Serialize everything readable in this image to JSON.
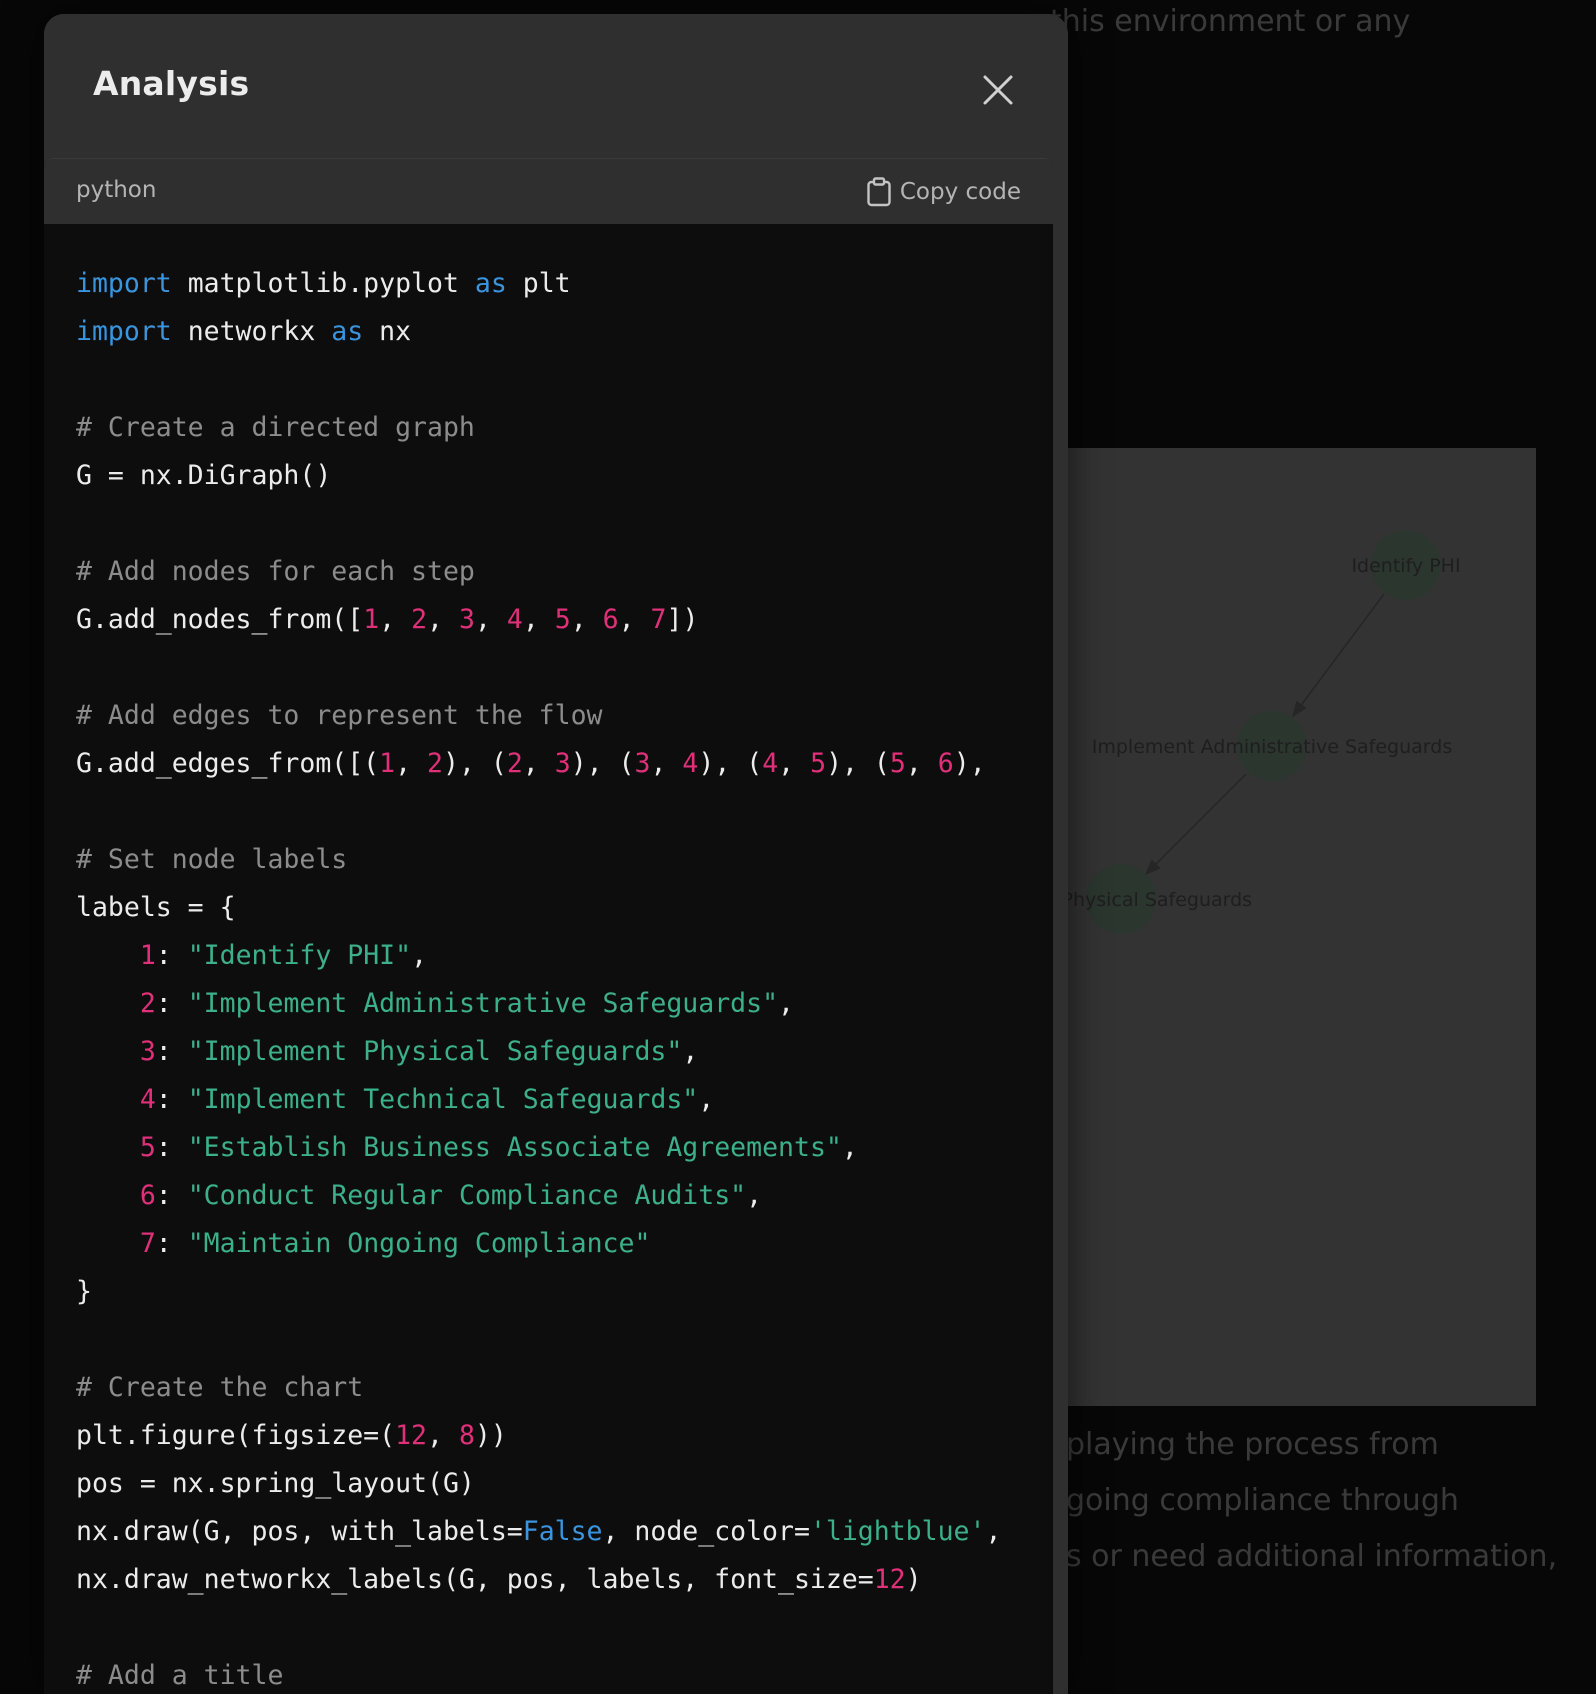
{
  "background": {
    "top_text": "this environment or any",
    "bottom_lines": [
      "playing the process from",
      "going compliance through",
      "s or need additional information,"
    ]
  },
  "plot": {
    "node_color": "#2b362f",
    "edge_color": "#262626",
    "label_color": "#1e1e1e",
    "visible_nodes": [
      {
        "label": "Identify PHI"
      },
      {
        "label": "Implement Administrative Safeguards"
      },
      {
        "label": "t Physical Safeguards"
      }
    ]
  },
  "modal": {
    "title": "Analysis",
    "close_icon": "close-icon"
  },
  "code_block": {
    "language": "python",
    "copy_label": "Copy code",
    "copy_icon": "clipboard-icon",
    "lines": [
      [
        {
          "t": "import",
          "c": "kw"
        },
        {
          "t": " matplotlib.pyplot "
        },
        {
          "t": "as",
          "c": "kw"
        },
        {
          "t": " plt"
        }
      ],
      [
        {
          "t": "import",
          "c": "kw"
        },
        {
          "t": " networkx "
        },
        {
          "t": "as",
          "c": "kw"
        },
        {
          "t": " nx"
        }
      ],
      [],
      [
        {
          "t": "# Create a directed graph",
          "c": "cmt"
        }
      ],
      [
        {
          "t": "G = nx.DiGraph()"
        }
      ],
      [],
      [
        {
          "t": "# Add nodes for each step",
          "c": "cmt"
        }
      ],
      [
        {
          "t": "G.add_nodes_from(["
        },
        {
          "t": "1",
          "c": "num"
        },
        {
          "t": ", "
        },
        {
          "t": "2",
          "c": "num"
        },
        {
          "t": ", "
        },
        {
          "t": "3",
          "c": "num"
        },
        {
          "t": ", "
        },
        {
          "t": "4",
          "c": "num"
        },
        {
          "t": ", "
        },
        {
          "t": "5",
          "c": "num"
        },
        {
          "t": ", "
        },
        {
          "t": "6",
          "c": "num"
        },
        {
          "t": ", "
        },
        {
          "t": "7",
          "c": "num"
        },
        {
          "t": "])"
        }
      ],
      [],
      [
        {
          "t": "# Add edges to represent the flow",
          "c": "cmt"
        }
      ],
      [
        {
          "t": "G.add_edges_from([("
        },
        {
          "t": "1",
          "c": "num"
        },
        {
          "t": ", "
        },
        {
          "t": "2",
          "c": "num"
        },
        {
          "t": "), ("
        },
        {
          "t": "2",
          "c": "num"
        },
        {
          "t": ", "
        },
        {
          "t": "3",
          "c": "num"
        },
        {
          "t": "), ("
        },
        {
          "t": "3",
          "c": "num"
        },
        {
          "t": ", "
        },
        {
          "t": "4",
          "c": "num"
        },
        {
          "t": "), ("
        },
        {
          "t": "4",
          "c": "num"
        },
        {
          "t": ", "
        },
        {
          "t": "5",
          "c": "num"
        },
        {
          "t": "), ("
        },
        {
          "t": "5",
          "c": "num"
        },
        {
          "t": ", "
        },
        {
          "t": "6",
          "c": "num"
        },
        {
          "t": "),"
        }
      ],
      [],
      [
        {
          "t": "# Set node labels",
          "c": "cmt"
        }
      ],
      [
        {
          "t": "labels = {"
        }
      ],
      [
        {
          "t": "    "
        },
        {
          "t": "1",
          "c": "num"
        },
        {
          "t": ": "
        },
        {
          "t": "\"Identify PHI\"",
          "c": "str"
        },
        {
          "t": ","
        }
      ],
      [
        {
          "t": "    "
        },
        {
          "t": "2",
          "c": "num"
        },
        {
          "t": ": "
        },
        {
          "t": "\"Implement Administrative Safeguards\"",
          "c": "str"
        },
        {
          "t": ","
        }
      ],
      [
        {
          "t": "    "
        },
        {
          "t": "3",
          "c": "num"
        },
        {
          "t": ": "
        },
        {
          "t": "\"Implement Physical Safeguards\"",
          "c": "str"
        },
        {
          "t": ","
        }
      ],
      [
        {
          "t": "    "
        },
        {
          "t": "4",
          "c": "num"
        },
        {
          "t": ": "
        },
        {
          "t": "\"Implement Technical Safeguards\"",
          "c": "str"
        },
        {
          "t": ","
        }
      ],
      [
        {
          "t": "    "
        },
        {
          "t": "5",
          "c": "num"
        },
        {
          "t": ": "
        },
        {
          "t": "\"Establish Business Associate Agreements\"",
          "c": "str"
        },
        {
          "t": ","
        }
      ],
      [
        {
          "t": "    "
        },
        {
          "t": "6",
          "c": "num"
        },
        {
          "t": ": "
        },
        {
          "t": "\"Conduct Regular Compliance Audits\"",
          "c": "str"
        },
        {
          "t": ","
        }
      ],
      [
        {
          "t": "    "
        },
        {
          "t": "7",
          "c": "num"
        },
        {
          "t": ": "
        },
        {
          "t": "\"Maintain Ongoing Compliance\"",
          "c": "str"
        }
      ],
      [
        {
          "t": "}"
        }
      ],
      [],
      [
        {
          "t": "# Create the chart",
          "c": "cmt"
        }
      ],
      [
        {
          "t": "plt.figure(figsize=("
        },
        {
          "t": "12",
          "c": "num"
        },
        {
          "t": ", "
        },
        {
          "t": "8",
          "c": "num"
        },
        {
          "t": "))"
        }
      ],
      [
        {
          "t": "pos = nx.spring_layout(G)"
        }
      ],
      [
        {
          "t": "nx.draw(G, pos, with_labels="
        },
        {
          "t": "False",
          "c": "kw"
        },
        {
          "t": ", node_color="
        },
        {
          "t": "'lightblue'",
          "c": "str"
        },
        {
          "t": ","
        }
      ],
      [
        {
          "t": "nx.draw_networkx_labels(G, pos, labels, font_size="
        },
        {
          "t": "12",
          "c": "num"
        },
        {
          "t": ")"
        }
      ],
      [],
      [
        {
          "t": "# Add a title",
          "c": "cmt"
        }
      ]
    ]
  }
}
